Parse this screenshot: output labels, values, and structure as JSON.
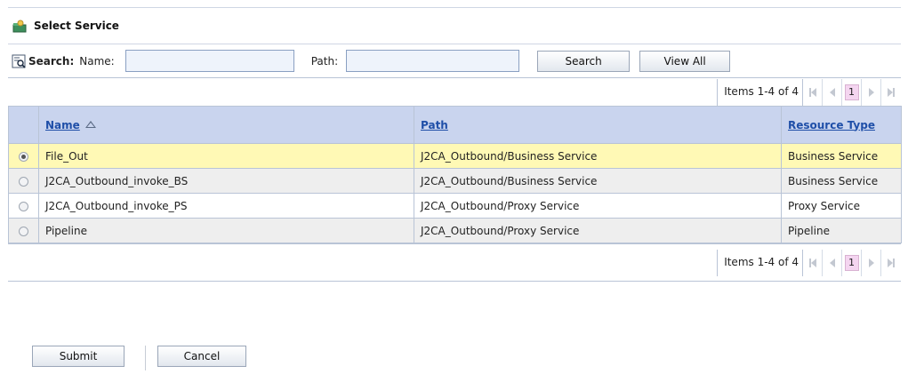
{
  "dialog": {
    "title": "Select Service",
    "title_icon": "service-folder-icon"
  },
  "search": {
    "label": "Search:",
    "name_label": "Name:",
    "name_value": "",
    "path_label": "Path:",
    "path_value": "",
    "search_button": "Search",
    "view_all_button": "View All",
    "icon": "search-icon"
  },
  "pager_top": {
    "items_text": "Items 1-4 of 4",
    "current_page": "1"
  },
  "table": {
    "columns": [
      {
        "label": "Name",
        "sort": "ascending"
      },
      {
        "label": "Path"
      },
      {
        "label": "Resource Type"
      }
    ],
    "rows": [
      {
        "selected": true,
        "name": "File_Out",
        "path": "J2CA_Outbound/Business Service",
        "type": "Business Service"
      },
      {
        "selected": false,
        "name": "J2CA_Outbound_invoke_BS",
        "path": "J2CA_Outbound/Business Service",
        "type": "Business Service"
      },
      {
        "selected": false,
        "name": "J2CA_Outbound_invoke_PS",
        "path": "J2CA_Outbound/Proxy Service",
        "type": "Proxy Service"
      },
      {
        "selected": false,
        "name": "Pipeline",
        "path": "J2CA_Outbound/Proxy Service",
        "type": "Pipeline"
      }
    ]
  },
  "pager_bottom": {
    "items_text": "Items 1-4 of 4",
    "current_page": "1"
  },
  "actions": {
    "submit": "Submit",
    "cancel": "Cancel"
  },
  "colors": {
    "header_bg": "#c9d4ee",
    "header_link": "#1f4fa8",
    "selected_row": "#fff9b5",
    "alt_row": "#eeeeee",
    "page_highlight": "#f4d5f0"
  }
}
